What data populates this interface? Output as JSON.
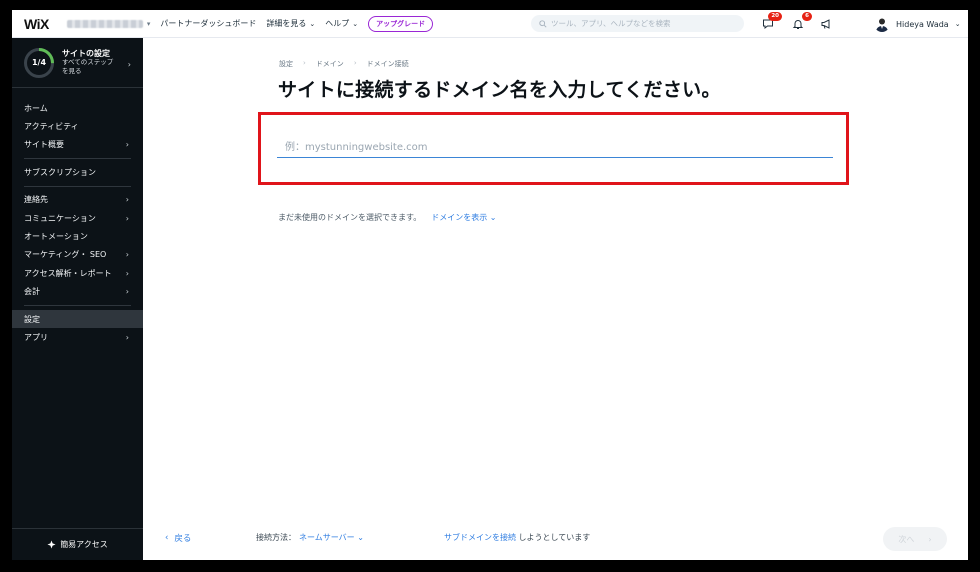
{
  "topbar": {
    "logo": "WiX",
    "menu": [
      {
        "label": "パートナーダッシュボード"
      },
      {
        "label": "詳細を見る",
        "chevron": "⌄"
      },
      {
        "label": "ヘルプ",
        "chevron": "⌄"
      }
    ],
    "upgrade_label": "アップグレード",
    "search_placeholder": "ツール、アプリ、ヘルプなどを検索",
    "inbox_badge": "20",
    "notifications_badge": "6",
    "user_name": "Hideya Wada"
  },
  "sidebar": {
    "progress": "1/4",
    "progress_fraction": 0.25,
    "setup_title": "サイトの設定",
    "setup_sub_1": "すべてのステップ",
    "setup_sub_2": "を見る",
    "groups": [
      [
        {
          "label": "ホーム",
          "arrow": ""
        },
        {
          "label": "アクティビティ",
          "arrow": ""
        },
        {
          "label": "サイト概要",
          "arrow": "›"
        }
      ],
      [
        {
          "label": "サブスクリプション",
          "arrow": ""
        }
      ],
      [
        {
          "label": "連絡先",
          "arrow": "›"
        },
        {
          "label": "コミュニケーション",
          "arrow": "›"
        },
        {
          "label": "オートメーション",
          "arrow": ""
        },
        {
          "label": "マーケティング・ SEO",
          "arrow": "›"
        },
        {
          "label": "アクセス解析・レポート",
          "arrow": "›"
        },
        {
          "label": "会計",
          "arrow": "›"
        }
      ],
      [
        {
          "label": "設定",
          "arrow": "",
          "active": true
        },
        {
          "label": "アプリ",
          "arrow": "›"
        }
      ]
    ],
    "quick_access": "簡易アクセス"
  },
  "main": {
    "breadcrumb": [
      "設定",
      "ドメイン",
      "ドメイン接続"
    ],
    "title": "サイトに接続するドメイン名を入力してください。",
    "input_placeholder": "例：mystunningwebsite.com",
    "input_value": "",
    "unused_text": "まだ未使用のドメインを選択できます。",
    "show_domains_link": "ドメインを表示 ⌄"
  },
  "footer": {
    "back_label": "戻る",
    "method_label": "接続方法：",
    "method_value": "ネームサーバー ⌄",
    "subdomain_link": "サブドメインを接続",
    "subdomain_text": "しようとしています",
    "next_label": "次へ"
  },
  "colors": {
    "accent": "#2f7de1",
    "sidebar_bg": "#0c1217",
    "highlight": "#e0141a",
    "upgrade": "#9a27d5",
    "badge": "#e62214",
    "progress_ring": "#60bc57"
  }
}
